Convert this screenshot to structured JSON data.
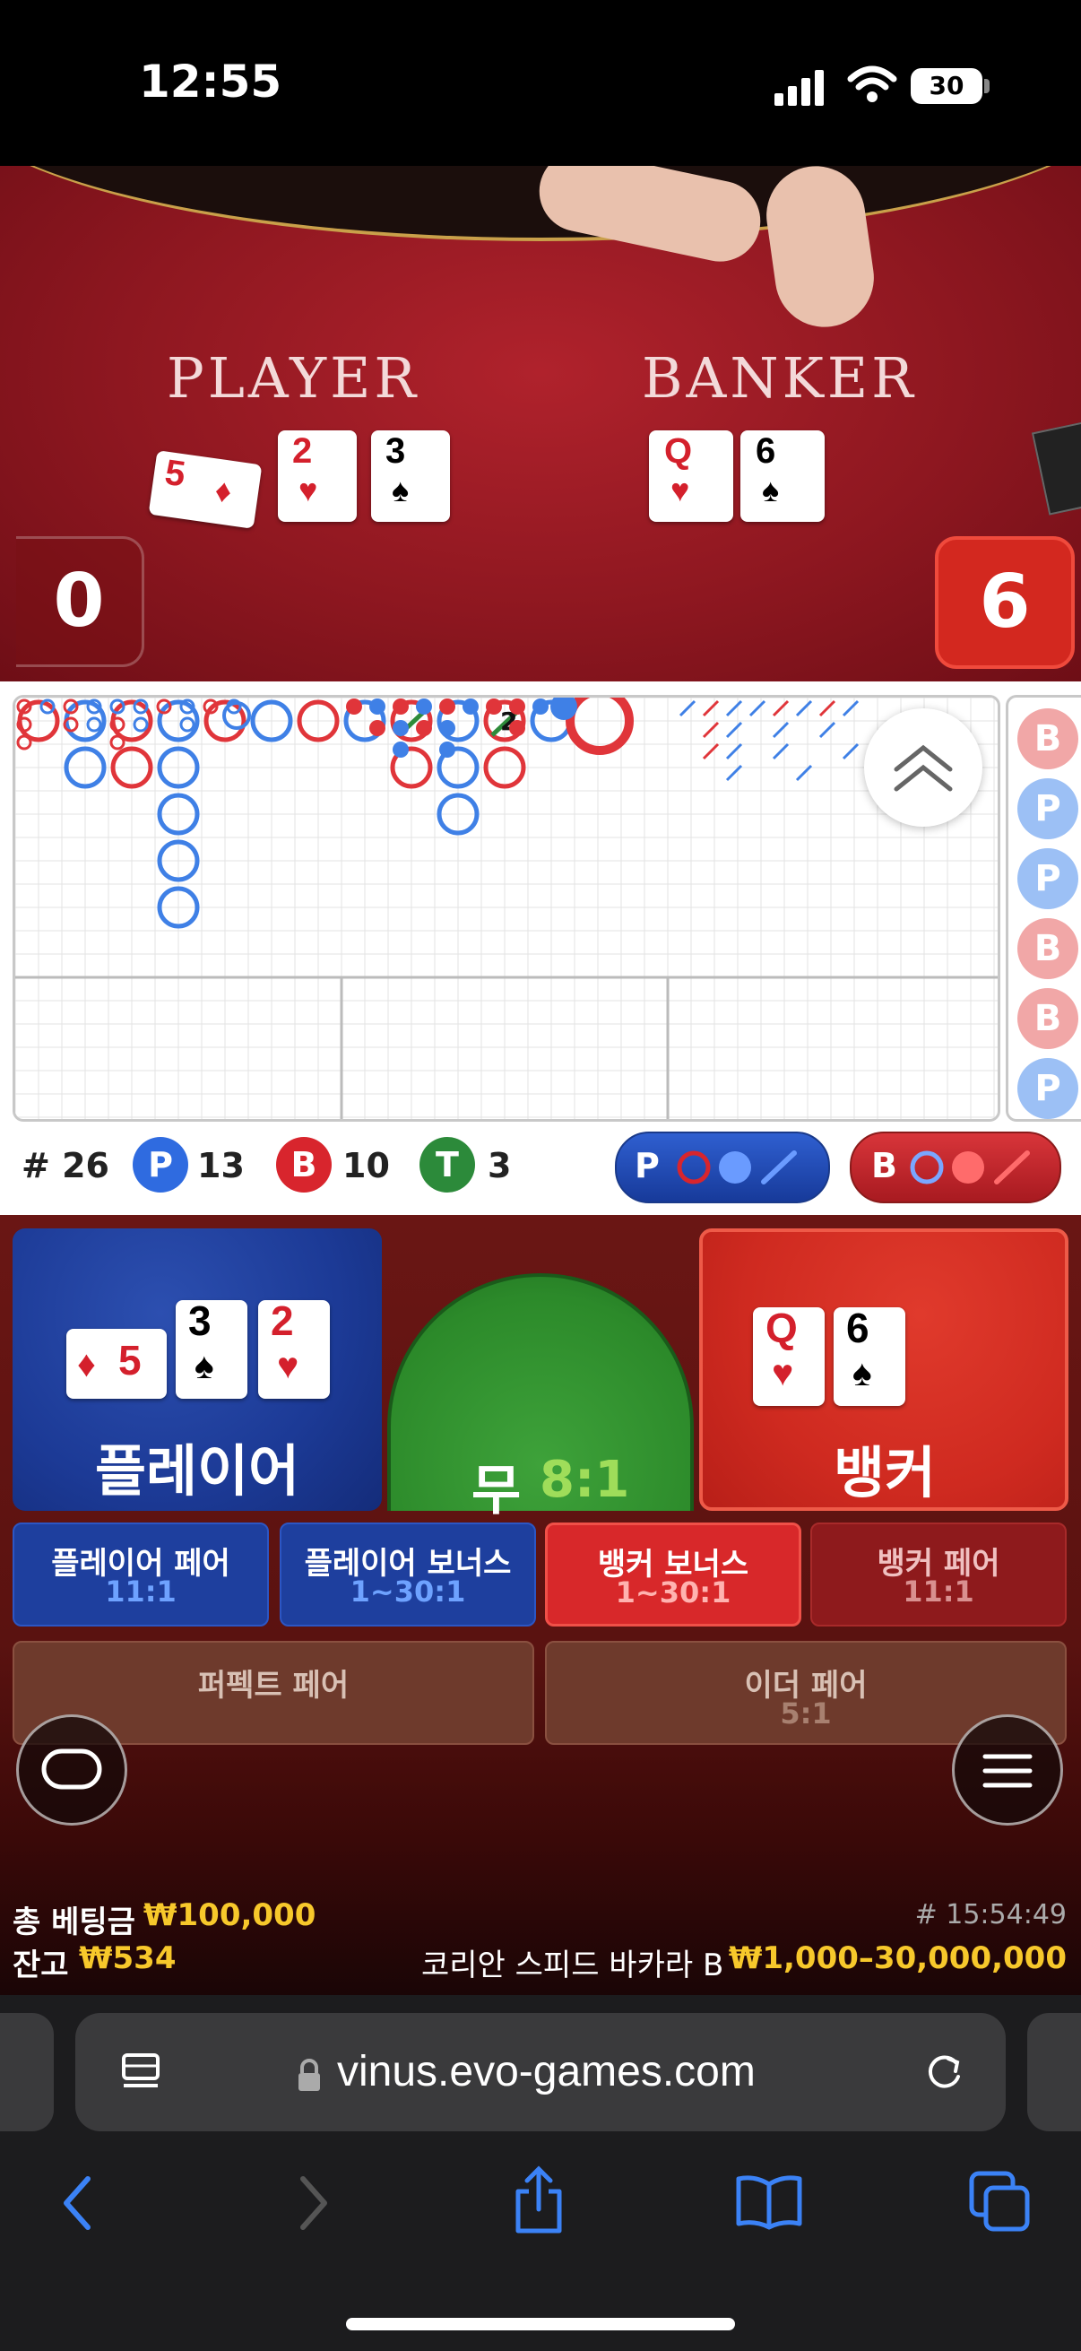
{
  "status_bar": {
    "time": "12:55",
    "battery": "30"
  },
  "video": {
    "player_label": "PLAYER",
    "banker_label": "BANKER",
    "player_cards": [
      {
        "rank": "5",
        "suit": "♦",
        "color": "red",
        "rotated": true
      },
      {
        "rank": "2",
        "suit": "♥",
        "color": "red"
      },
      {
        "rank": "3",
        "suit": "♠",
        "color": "black"
      }
    ],
    "banker_cards": [
      {
        "rank": "Q",
        "suit": "♥",
        "color": "red"
      },
      {
        "rank": "6",
        "suit": "♠",
        "color": "black"
      }
    ],
    "player_score": "0",
    "banker_score": "6"
  },
  "roadmap": {
    "big_road_marker": "2",
    "side_road": [
      "B",
      "P",
      "P",
      "B",
      "B",
      "P"
    ]
  },
  "stats": {
    "round_count": "# 26",
    "player_label": "P",
    "player_count": "13",
    "banker_label": "B",
    "banker_count": "10",
    "tie_label": "T",
    "tie_count": "3",
    "player_predict_label": "P",
    "banker_predict_label": "B"
  },
  "betting": {
    "player": "플레이어",
    "banker": "뱅커",
    "tie": "무",
    "tie_odds": "8:1",
    "player_pair": "플레이어 페어",
    "player_pair_odds": "11:1",
    "player_bonus": "플레이어 보너스",
    "player_bonus_odds": "1~30:1",
    "banker_bonus": "뱅커 보너스",
    "banker_bonus_odds": "1~30:1",
    "banker_pair": "뱅커 페어",
    "banker_pair_odds": "11:1",
    "perfect_pair": "퍼펙트 페어",
    "either_pair": "이더 페어",
    "either_pair_odds": "5:1",
    "player_cards": [
      {
        "rank": "5",
        "suit": "♦",
        "color": "red",
        "rotated": true
      },
      {
        "rank": "3",
        "suit": "♠",
        "color": "black"
      },
      {
        "rank": "2",
        "suit": "♥",
        "color": "red"
      }
    ],
    "banker_cards": [
      {
        "rank": "Q",
        "suit": "♥",
        "color": "red"
      },
      {
        "rank": "6",
        "suit": "♠",
        "color": "black"
      }
    ]
  },
  "info": {
    "total_bet_label": "총 베팅금",
    "total_bet_value": "₩100,000",
    "balance_label": "잔고",
    "balance_value": "₩534",
    "round_id": "# 15:54:49",
    "table_name": "코리안 스피드 바카라 B",
    "limits": "₩1,000–30,000,000"
  },
  "browser": {
    "url": "vinus.evo-games.com"
  },
  "colors": {
    "player_blue": "#2f5fd0",
    "banker_red": "#d8252d",
    "tie_green": "#2c8a2a",
    "gold": "#f7c82b"
  }
}
